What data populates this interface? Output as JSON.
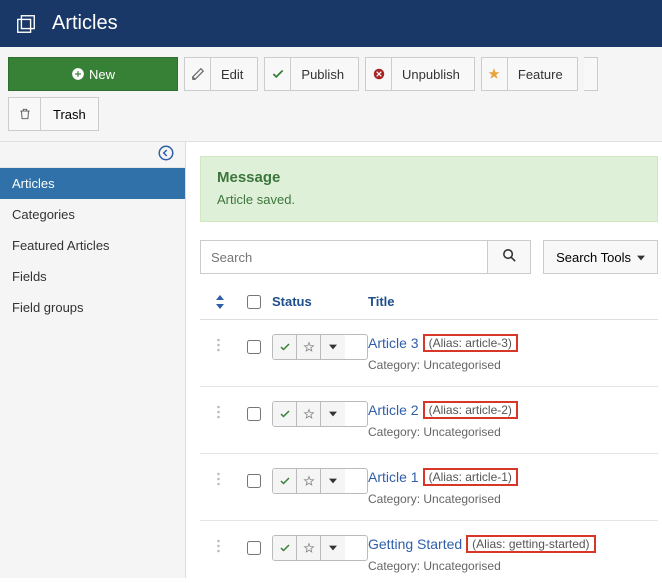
{
  "header": {
    "title": "Articles"
  },
  "toolbar": {
    "new": "New",
    "edit": "Edit",
    "publish": "Publish",
    "unpublish": "Unpublish",
    "feature": "Feature",
    "trash": "Trash"
  },
  "sidebar": {
    "items": [
      {
        "label": "Articles",
        "active": true
      },
      {
        "label": "Categories",
        "active": false
      },
      {
        "label": "Featured Articles",
        "active": false
      },
      {
        "label": "Fields",
        "active": false
      },
      {
        "label": "Field groups",
        "active": false
      }
    ]
  },
  "message": {
    "title": "Message",
    "text": "Article saved."
  },
  "search": {
    "placeholder": "Search",
    "tools_label": "Search Tools"
  },
  "columns": {
    "status": "Status",
    "title": "Title"
  },
  "rows": [
    {
      "title": "Article 3",
      "alias": "(Alias: article-3)",
      "category": "Category: Uncategorised"
    },
    {
      "title": "Article 2",
      "alias": "(Alias: article-2)",
      "category": "Category: Uncategorised"
    },
    {
      "title": "Article 1",
      "alias": "(Alias: article-1)",
      "category": "Category: Uncategorised"
    },
    {
      "title": "Getting Started",
      "alias": "(Alias: getting-started)",
      "category": "Category: Uncategorised"
    }
  ]
}
